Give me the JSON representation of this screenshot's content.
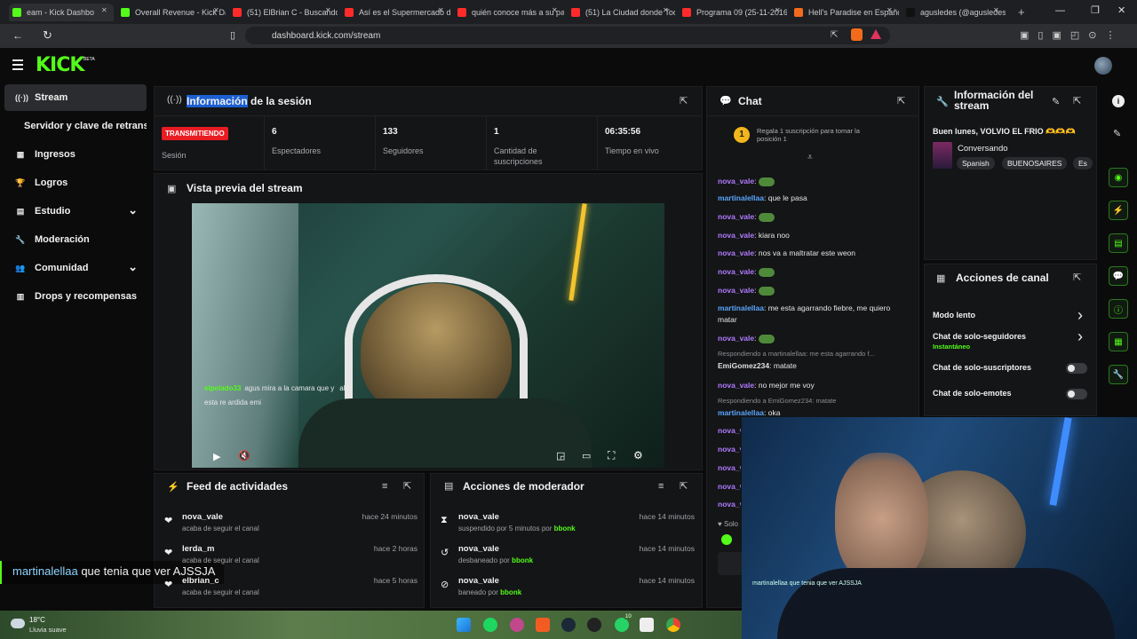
{
  "browser": {
    "tabs": [
      {
        "label": "eam - Kick Dashbo",
        "active": true,
        "color": "#53fc18"
      },
      {
        "label": "Overall Revenue - Kick Da",
        "color": "#53fc18"
      },
      {
        "label": "(51) ElBrian C - Buscando",
        "color": "#ff2b2b"
      },
      {
        "label": "Así es el Supermercado de",
        "color": "#ff2b2b"
      },
      {
        "label": "quién conoce más a su pa",
        "color": "#ff2b2b"
      },
      {
        "label": "(51) La Ciudad donde Tod",
        "color": "#ff2b2b"
      },
      {
        "label": "Programa 09 (25-11-2016",
        "color": "#ff2b2b"
      },
      {
        "label": "Hell's Paradise en Españo",
        "color": "#f26b1d"
      },
      {
        "label": "agusledes (@agusledes14",
        "color": "#111111"
      }
    ],
    "url": "dashboard.kick.com/stream"
  },
  "header": {
    "logo": "KICK",
    "beta": "BETA"
  },
  "sidebar": {
    "items": [
      {
        "label": "Stream",
        "icon": "broadcast-icon",
        "glyph": "((·))",
        "active": true
      },
      {
        "label": "Servidor y clave de retransmisión",
        "icon": "",
        "glyph": ""
      },
      {
        "label": "Ingresos",
        "icon": "income-icon",
        "glyph": "▦"
      },
      {
        "label": "Logros",
        "icon": "trophy-icon",
        "glyph": "🏆"
      },
      {
        "label": "Estudio",
        "icon": "studio-icon",
        "glyph": "▤",
        "chevron": true
      },
      {
        "label": "Moderación",
        "icon": "wrench-icon",
        "glyph": "🔧"
      },
      {
        "label": "Comunidad",
        "icon": "community-icon",
        "glyph": "👥",
        "chevron": true
      },
      {
        "label": "Drops y recompensas",
        "icon": "drops-icon",
        "glyph": "▥"
      }
    ]
  },
  "session": {
    "title_highlight": "Información",
    "title_rest": " de la sesión",
    "status_badge": "TRANSMITIENDO",
    "status_label": "Sesión",
    "stats": [
      {
        "value": "6",
        "label": "Espectadores"
      },
      {
        "value": "133",
        "label": "Seguidores"
      },
      {
        "value": "1",
        "label": "Cantidad de suscripciones"
      },
      {
        "value": "06:35:56",
        "label": "Tiempo en vivo"
      }
    ]
  },
  "preview": {
    "title": "Vista previa del stream",
    "overlay_chat": [
      {
        "user": "elpelado33",
        "text": "agus mira a la camara que y",
        "suffix": "abo"
      },
      {
        "user": "",
        "text": "esta re ardida emi"
      }
    ]
  },
  "chat": {
    "title": "Chat",
    "sub_promo": "Regala 1 suscripción para tomar la posición 1",
    "lines": [
      {
        "user": "nova_vale",
        "text": "",
        "emote": true
      },
      {
        "user": "martinalellaa",
        "text": "que le pasa"
      },
      {
        "user": "nova_vale",
        "text": "",
        "emote": true
      },
      {
        "user": "nova_vale",
        "text": "kiara noo"
      },
      {
        "user": "nova_vale",
        "text": "nos va a maltratar este weon"
      },
      {
        "user": "nova_vale",
        "text": "",
        "emote": true
      },
      {
        "user": "nova_vale",
        "text": "",
        "emote": true
      },
      {
        "user": "martinalellaa",
        "text": "me esta agarrando fiebre, me quiero matar"
      },
      {
        "user": "nova_vale",
        "text": "",
        "emote": true
      },
      {
        "user": "EmiGomez234",
        "text": "matate"
      },
      {
        "user": "nova_vale",
        "text": "no mejor me voy"
      },
      {
        "user": "martinalellaa",
        "text": "oka"
      }
    ],
    "replies": [
      "Respondiendo a martinalellaa: me esta agarrando f...",
      "Respondiendo a EmiGomez234: matate"
    ],
    "bottom_text": "Solo"
  },
  "stream_info": {
    "title": "Información del stream",
    "stream_title": "Buen lunes, VOLVIO EL FRIO 🫶🫶🫶",
    "category": "Conversando",
    "tags": [
      "Spanish",
      "BUENOSAIRES",
      "Es"
    ]
  },
  "channel_actions": {
    "title": "Acciones de canal",
    "items": [
      {
        "label": "Modo lento",
        "type": "chevron"
      },
      {
        "label": "Chat de solo-seguidores",
        "sub": "Instantáneo",
        "type": "chevron"
      },
      {
        "label": "Chat de solo-suscriptores",
        "type": "toggle"
      },
      {
        "label": "Chat de solo-emotes",
        "type": "toggle"
      }
    ]
  },
  "activity_feed": {
    "title": "Feed de actividades",
    "items": [
      {
        "name": "nova_vale",
        "sub": "acaba de seguir el canal",
        "time": "hace 24 minutos"
      },
      {
        "name": "lerda_m",
        "sub": "acaba de seguir el canal",
        "time": "hace 2 horas"
      },
      {
        "name": "elbrian_c",
        "sub": "acaba de seguir el canal",
        "time": "hace 5 horas"
      }
    ]
  },
  "mod_actions": {
    "title": "Acciones de moderador",
    "items": [
      {
        "name": "nova_vale",
        "sub_pre": "suspendido por 5 minutos por ",
        "by": "bbonk",
        "time": "hace 14 minutos"
      },
      {
        "name": "nova_vale",
        "sub_pre": "desbaneado por ",
        "by": "bbonk",
        "time": "hace 14 minutos"
      },
      {
        "name": "nova_vale",
        "sub_pre": "baneado por ",
        "by": "bbonk",
        "time": "hace 14 minutos"
      }
    ]
  },
  "overlay_subtitle": {
    "user": "martinalellaa",
    "text": "que tenia que ver AJSSJA"
  },
  "webcam_overlay": {
    "chat": "martinalellaa que tenia que ver AJSSJA"
  },
  "weather": {
    "temp": "18°C",
    "desc": "Lluvia suave"
  },
  "taskbar_badge": "10"
}
